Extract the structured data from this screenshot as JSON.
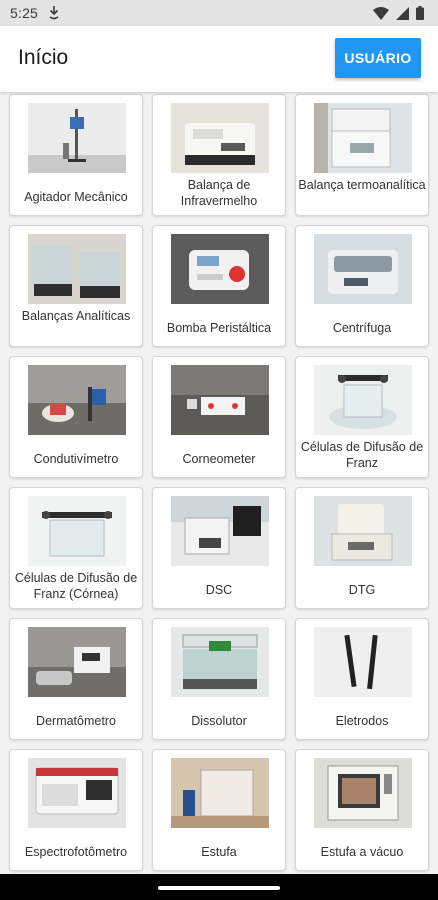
{
  "status": {
    "time": "5:25",
    "icons": [
      "download-notification-icon",
      "wifi-icon",
      "signal-icon",
      "battery-icon"
    ]
  },
  "appbar": {
    "title": "Início",
    "user_button": "USUÁRIO",
    "accent": "#2196f3"
  },
  "items": [
    {
      "label": "Agitador Mecânico",
      "image": "agitador"
    },
    {
      "label": "Balança de Infravermelho",
      "image": "balanca-infra"
    },
    {
      "label": "Balança termoanalítica",
      "image": "balanca-termo"
    },
    {
      "label": "Balanças Analíticas",
      "image": "balancas"
    },
    {
      "label": "Bomba Peristáltica",
      "image": "bomba"
    },
    {
      "label": "Centrífuga",
      "image": "centrifuga"
    },
    {
      "label": "Condutivímetro",
      "image": "condutivimetro"
    },
    {
      "label": "Corneometer",
      "image": "corneometer"
    },
    {
      "label": "Células de Difusão de Franz",
      "image": "franz"
    },
    {
      "label": "Células de Difusão de Franz (Córnea)",
      "image": "franz-cornea"
    },
    {
      "label": "DSC",
      "image": "dsc"
    },
    {
      "label": "DTG",
      "image": "dtg"
    },
    {
      "label": "Dermatômetro",
      "image": "dermatometro"
    },
    {
      "label": "Dissolutor",
      "image": "dissolutor"
    },
    {
      "label": "Eletrodos",
      "image": "eletrodos"
    },
    {
      "label": "Espectrofotômetro",
      "image": "espectro"
    },
    {
      "label": "Estufa",
      "image": "estufa"
    },
    {
      "label": "Estufa a vácuo",
      "image": "estufa-vacuo"
    }
  ]
}
